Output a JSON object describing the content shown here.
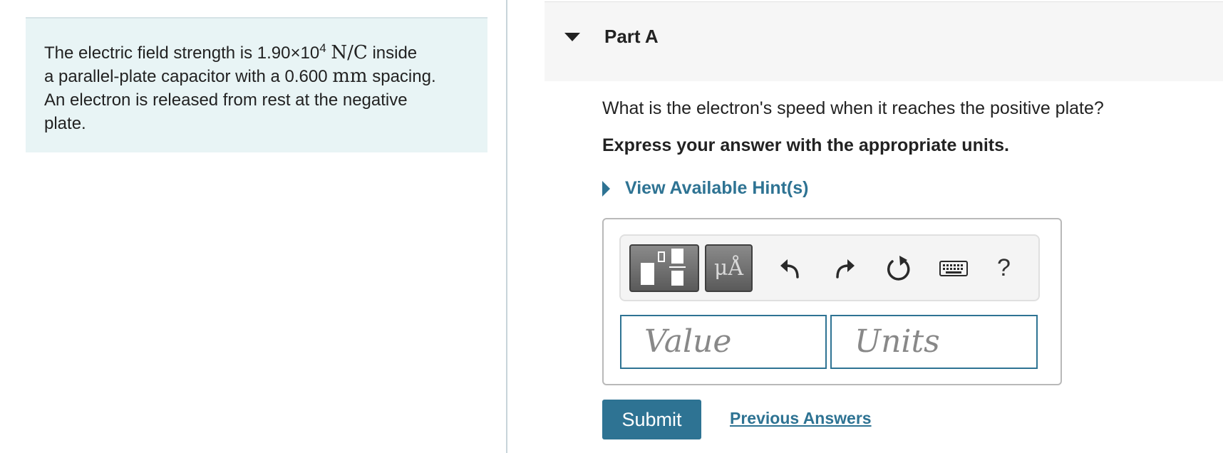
{
  "problem": {
    "line1_prefix": "The electric field strength is 1.90×10",
    "exponent": "4",
    "field_unit": "N/C",
    "line1_suffix": "inside",
    "line2_prefix": "a parallel-plate capacitor with a 0.600",
    "spacing_unit": "mm",
    "line2_suffix": "spacing.",
    "line3": "An electron is released from rest at the negative",
    "line4": "plate."
  },
  "part": {
    "title": "Part A",
    "question": "What is the electron's speed when it reaches the positive plate?",
    "instruction": "Express your answer with the appropriate units.",
    "hints_label": "View Available Hint(s)"
  },
  "toolbar": {
    "units_label": "μÅ",
    "help_label": "?",
    "icons": [
      "fraction-template-icon",
      "undo-icon",
      "redo-icon",
      "reset-icon",
      "keyboard-icon"
    ]
  },
  "inputs": {
    "value_placeholder": "Value",
    "units_placeholder": "Units"
  },
  "actions": {
    "submit_label": "Submit",
    "previous_answers_label": "Previous Answers"
  },
  "colors": {
    "accent": "#2e7393",
    "problem_bg": "#e8f4f5",
    "header_bg": "#f6f6f6"
  }
}
